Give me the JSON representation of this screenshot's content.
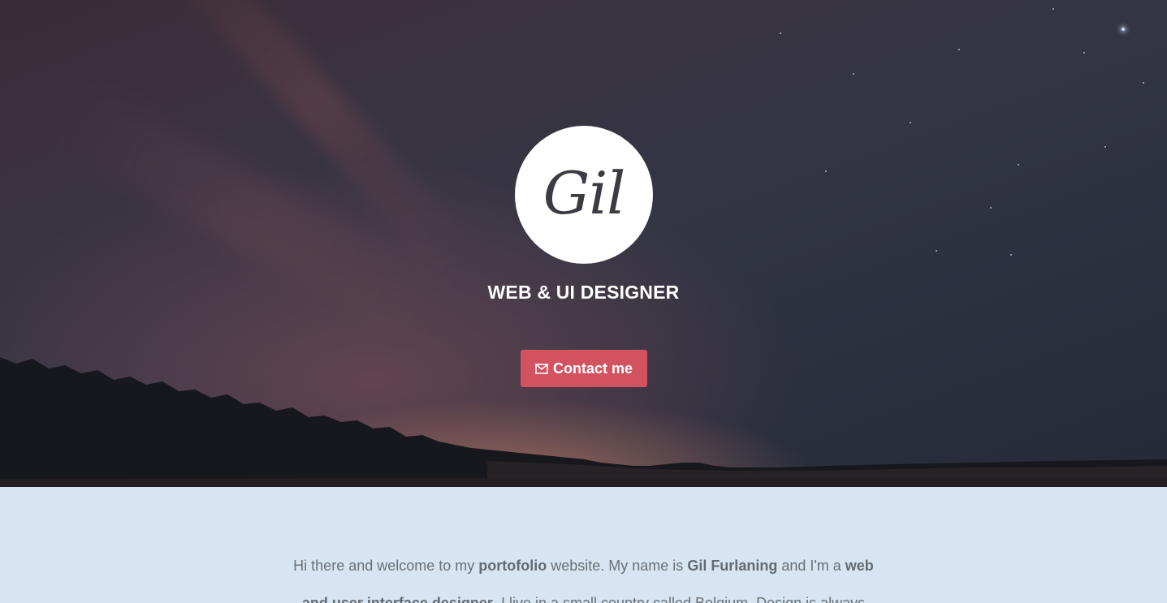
{
  "hero": {
    "logo_text": "Gil",
    "tagline": "WEB & UI DESIGNER",
    "contact_label": "Contact me",
    "button_color": "#d2525f"
  },
  "about": {
    "intro_1": "Hi there and welcome to my ",
    "portfolio": "portofolio",
    "intro_2": " website. My name is ",
    "name": "Gil Furlaning",
    "intro_3": " and I'm a ",
    "role": "web and user interface designer",
    "intro_4": ". I live in a small country called Belgium. Design is always",
    "background_color": "#d6e5f1"
  }
}
